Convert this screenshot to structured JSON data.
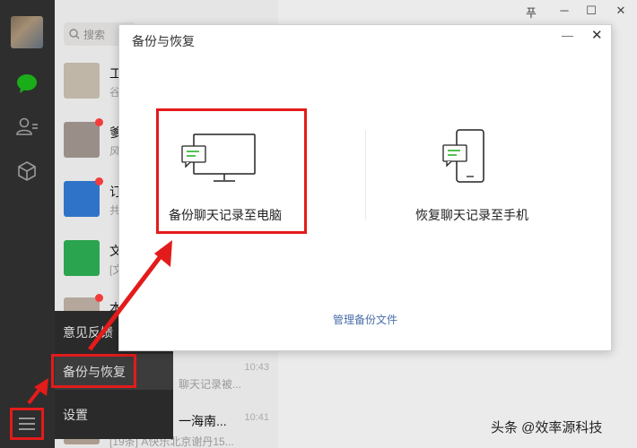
{
  "search": {
    "placeholder": "搜索"
  },
  "chat_list": [
    {
      "name": "工",
      "sub": "谷",
      "time": "",
      "thumb_color": "#bfb6a8",
      "unread": false
    },
    {
      "name": "爹",
      "sub": "风",
      "time": "",
      "thumb_color": "#9a8f88",
      "unread": true
    },
    {
      "name": "订",
      "sub": "共",
      "time": "",
      "thumb_color": "#2f73c9",
      "unread": true
    },
    {
      "name": "文",
      "sub": "[文",
      "time": "",
      "thumb_color": "#2aa44f",
      "unread": false
    },
    {
      "name": "本",
      "sub": "",
      "time": "",
      "thumb_color": "#b5a79b",
      "unread": true
    },
    {
      "name": "",
      "sub": "聊天记录被...",
      "time": "10:43",
      "thumb_color": "#e6e5e5",
      "unread": false
    },
    {
      "name": "一海南...",
      "sub": "[19条] A快乐北京谢丹15...",
      "time": "10:41",
      "thumb_color": "#a99b8d",
      "unread": false
    }
  ],
  "popup_menu": {
    "feedback": "意见反馈",
    "backup": "备份与恢复",
    "settings": "设置"
  },
  "window_controls": {
    "pin": "푸",
    "minimize": "─",
    "maximize": "☐",
    "close": "✕"
  },
  "dialog": {
    "title": "备份与恢复",
    "minimize": "—",
    "close": "✕",
    "backup_to_pc": "备份聊天记录至电脑",
    "restore_to_phone": "恢复聊天记录至手机",
    "manage_files": "管理备份文件"
  },
  "watermark": "头条 @效率源科技",
  "colors": {
    "accent_red": "#e31b1b",
    "wechat_green": "#1aad19",
    "link_blue": "#4a6ea8"
  }
}
